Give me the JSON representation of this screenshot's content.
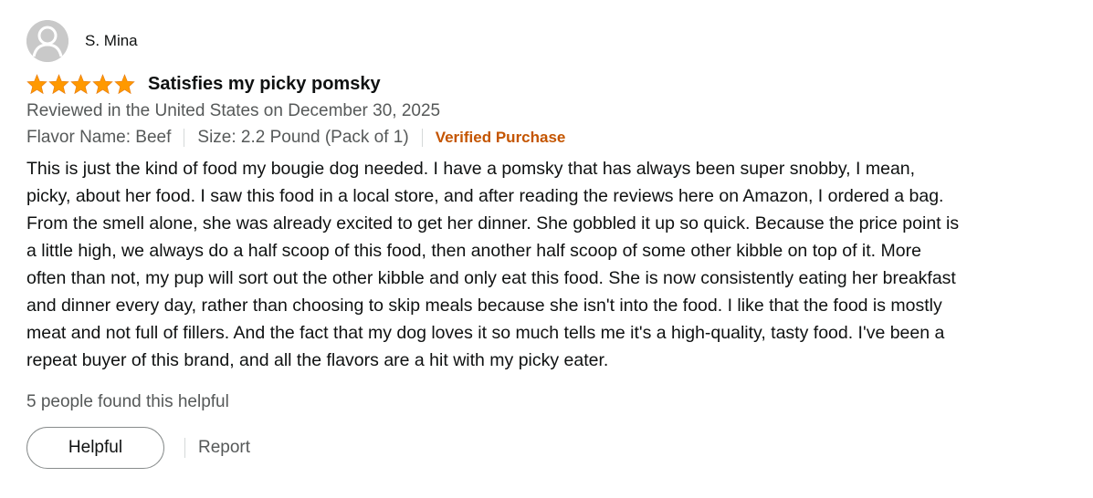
{
  "review": {
    "profile": {
      "name": "S. Mina",
      "avatar_icon": "default-user-avatar"
    },
    "rating": {
      "stars": 5,
      "max": 5,
      "star_color": "#ff9900"
    },
    "title": "Satisfies my picky pomsky",
    "date_line": "Reviewed in the United States on December 30, 2025",
    "flavor": "Flavor Name: Beef",
    "size": "Size: 2.2 Pound (Pack of 1)",
    "verified": "Verified Purchase",
    "verified_color": "#c45500",
    "body": "This is just the kind of food my bougie dog needed. I have a pomsky that has always been super snobby, I mean, picky, about her food. I saw this food in a local store, and after reading the reviews here on Amazon, I ordered a bag. From the smell alone, she was already excited to get her dinner. She gobbled it up so quick. Because the price point is a little high, we always do a half scoop of this food, then another half scoop of some other kibble on top of it. More often than not, my pup will sort out the other kibble and only eat this food. She is now consistently eating her breakfast and dinner every day, rather than choosing to skip meals because she isn't into the food. I like that the food is mostly meat and not full of fillers. And the fact that my dog loves it so much tells me it's a high-quality, tasty food. I've been a repeat buyer of this brand, and all the flavors are a hit with my picky eater.",
    "helpful_count": "5 people found this helpful",
    "helpful_button": "Helpful",
    "report_link": "Report"
  }
}
